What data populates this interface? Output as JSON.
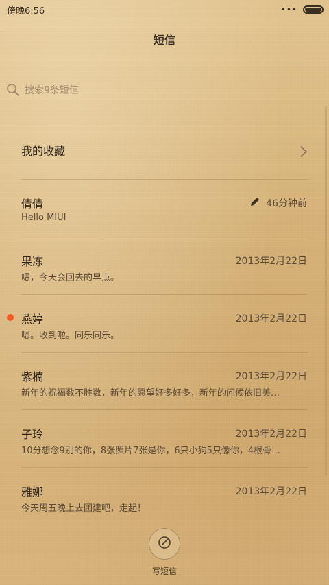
{
  "status_bar": {
    "time": "傍晚6:56",
    "signal_dots": "•••"
  },
  "title": "短信",
  "search": {
    "placeholder": "搜索9条短信"
  },
  "favorites": {
    "label": "我的收藏"
  },
  "conversations": [
    {
      "name": "倩倩",
      "preview": "Hello MIUI",
      "time": "46分钟前",
      "draft": true,
      "unread": false
    },
    {
      "name": "果冻",
      "preview": "嗯，今天会回去的早点。",
      "time": "2013年2月22日",
      "draft": false,
      "unread": false
    },
    {
      "name": "燕婷",
      "preview": "嗯。收到啦。同乐同乐。",
      "time": "2013年2月22日",
      "draft": false,
      "unread": true
    },
    {
      "name": "紫楠",
      "preview": "新年的祝福数不胜数，新年的愿望好多好多，新年的问候依旧美…",
      "time": "2013年2月22日",
      "draft": false,
      "unread": false
    },
    {
      "name": "子玲",
      "preview": "10分想念9别的你，8张照片7张是你，6只小狗5只像你，4根骨…",
      "time": "2013年2月22日",
      "draft": false,
      "unread": false
    },
    {
      "name": "雅娜",
      "preview": "今天周五晚上去团建吧，走起！",
      "time": "2013年2月22日",
      "draft": false,
      "unread": false
    }
  ],
  "compose": {
    "label": "写短信"
  },
  "colors": {
    "unread_dot": "#f15a24",
    "background": "#dbb87f"
  }
}
